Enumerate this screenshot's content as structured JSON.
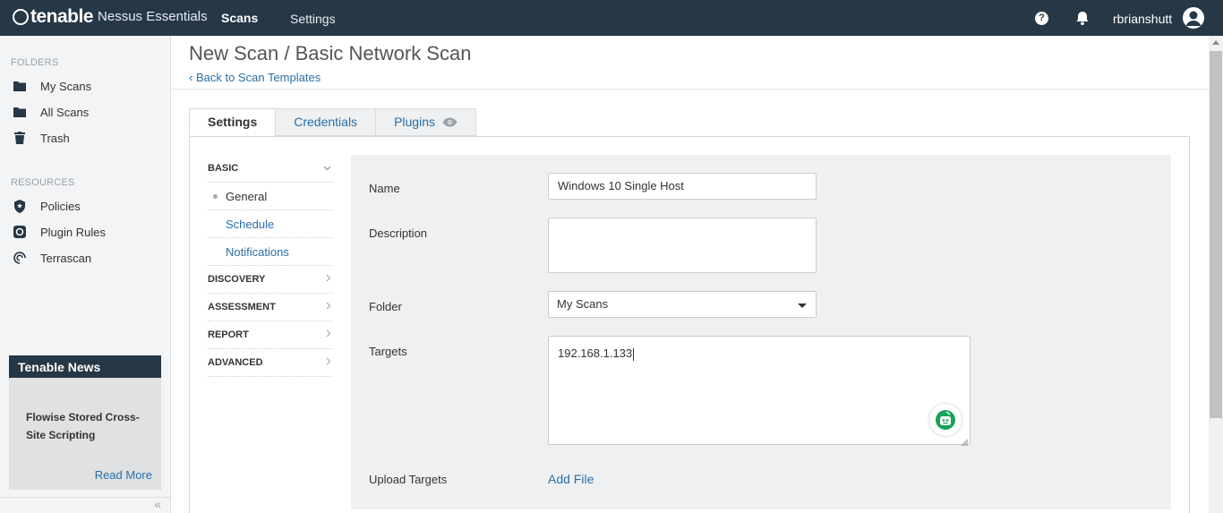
{
  "topbar": {
    "brand": "tenable",
    "product": "Nessus Essentials",
    "nav": {
      "scans": "Scans",
      "settings": "Settings"
    },
    "help_glyph": "?",
    "username": "rbrianshutt",
    "background": "#263746",
    "icons": [
      "help-icon",
      "bell-icon",
      "user-avatar-icon"
    ]
  },
  "sidebar": {
    "folders_heading": "FOLDERS",
    "folders": [
      {
        "label": "My Scans",
        "icon": "folder-icon"
      },
      {
        "label": "All Scans",
        "icon": "folder-icon"
      },
      {
        "label": "Trash",
        "icon": "trash-icon"
      }
    ],
    "resources_heading": "RESOURCES",
    "resources": [
      {
        "label": "Policies",
        "icon": "shield-icon"
      },
      {
        "label": "Plugin Rules",
        "icon": "plugin-icon"
      },
      {
        "label": "Terrascan",
        "icon": "terrascan-icon"
      }
    ],
    "news": {
      "heading": "Tenable News",
      "title": "Flowise Stored Cross-Site Scripting",
      "link": "Read More"
    },
    "collapse_glyph": "«"
  },
  "main": {
    "title": "New Scan / Basic Network Scan",
    "back_link": "Back to Scan Templates",
    "back_glyph": "‹",
    "tabs": [
      {
        "label": "Settings",
        "active": true
      },
      {
        "label": "Credentials",
        "active": false
      },
      {
        "label": "Plugins",
        "active": false
      }
    ],
    "section_nav": {
      "basic": "BASIC",
      "basic_items": [
        "General",
        "Schedule",
        "Notifications"
      ],
      "others": [
        "DISCOVERY",
        "ASSESSMENT",
        "REPORT",
        "ADVANCED"
      ]
    },
    "form": {
      "name_label": "Name",
      "name_value": "Windows 10 Single Host",
      "description_label": "Description",
      "description_value": "",
      "folder_label": "Folder",
      "folder_value": "My Scans",
      "targets_label": "Targets",
      "targets_value": "192.168.1.133",
      "upload_label": "Upload Targets",
      "add_file": "Add File"
    },
    "accent_color": "#2b6ea8"
  }
}
